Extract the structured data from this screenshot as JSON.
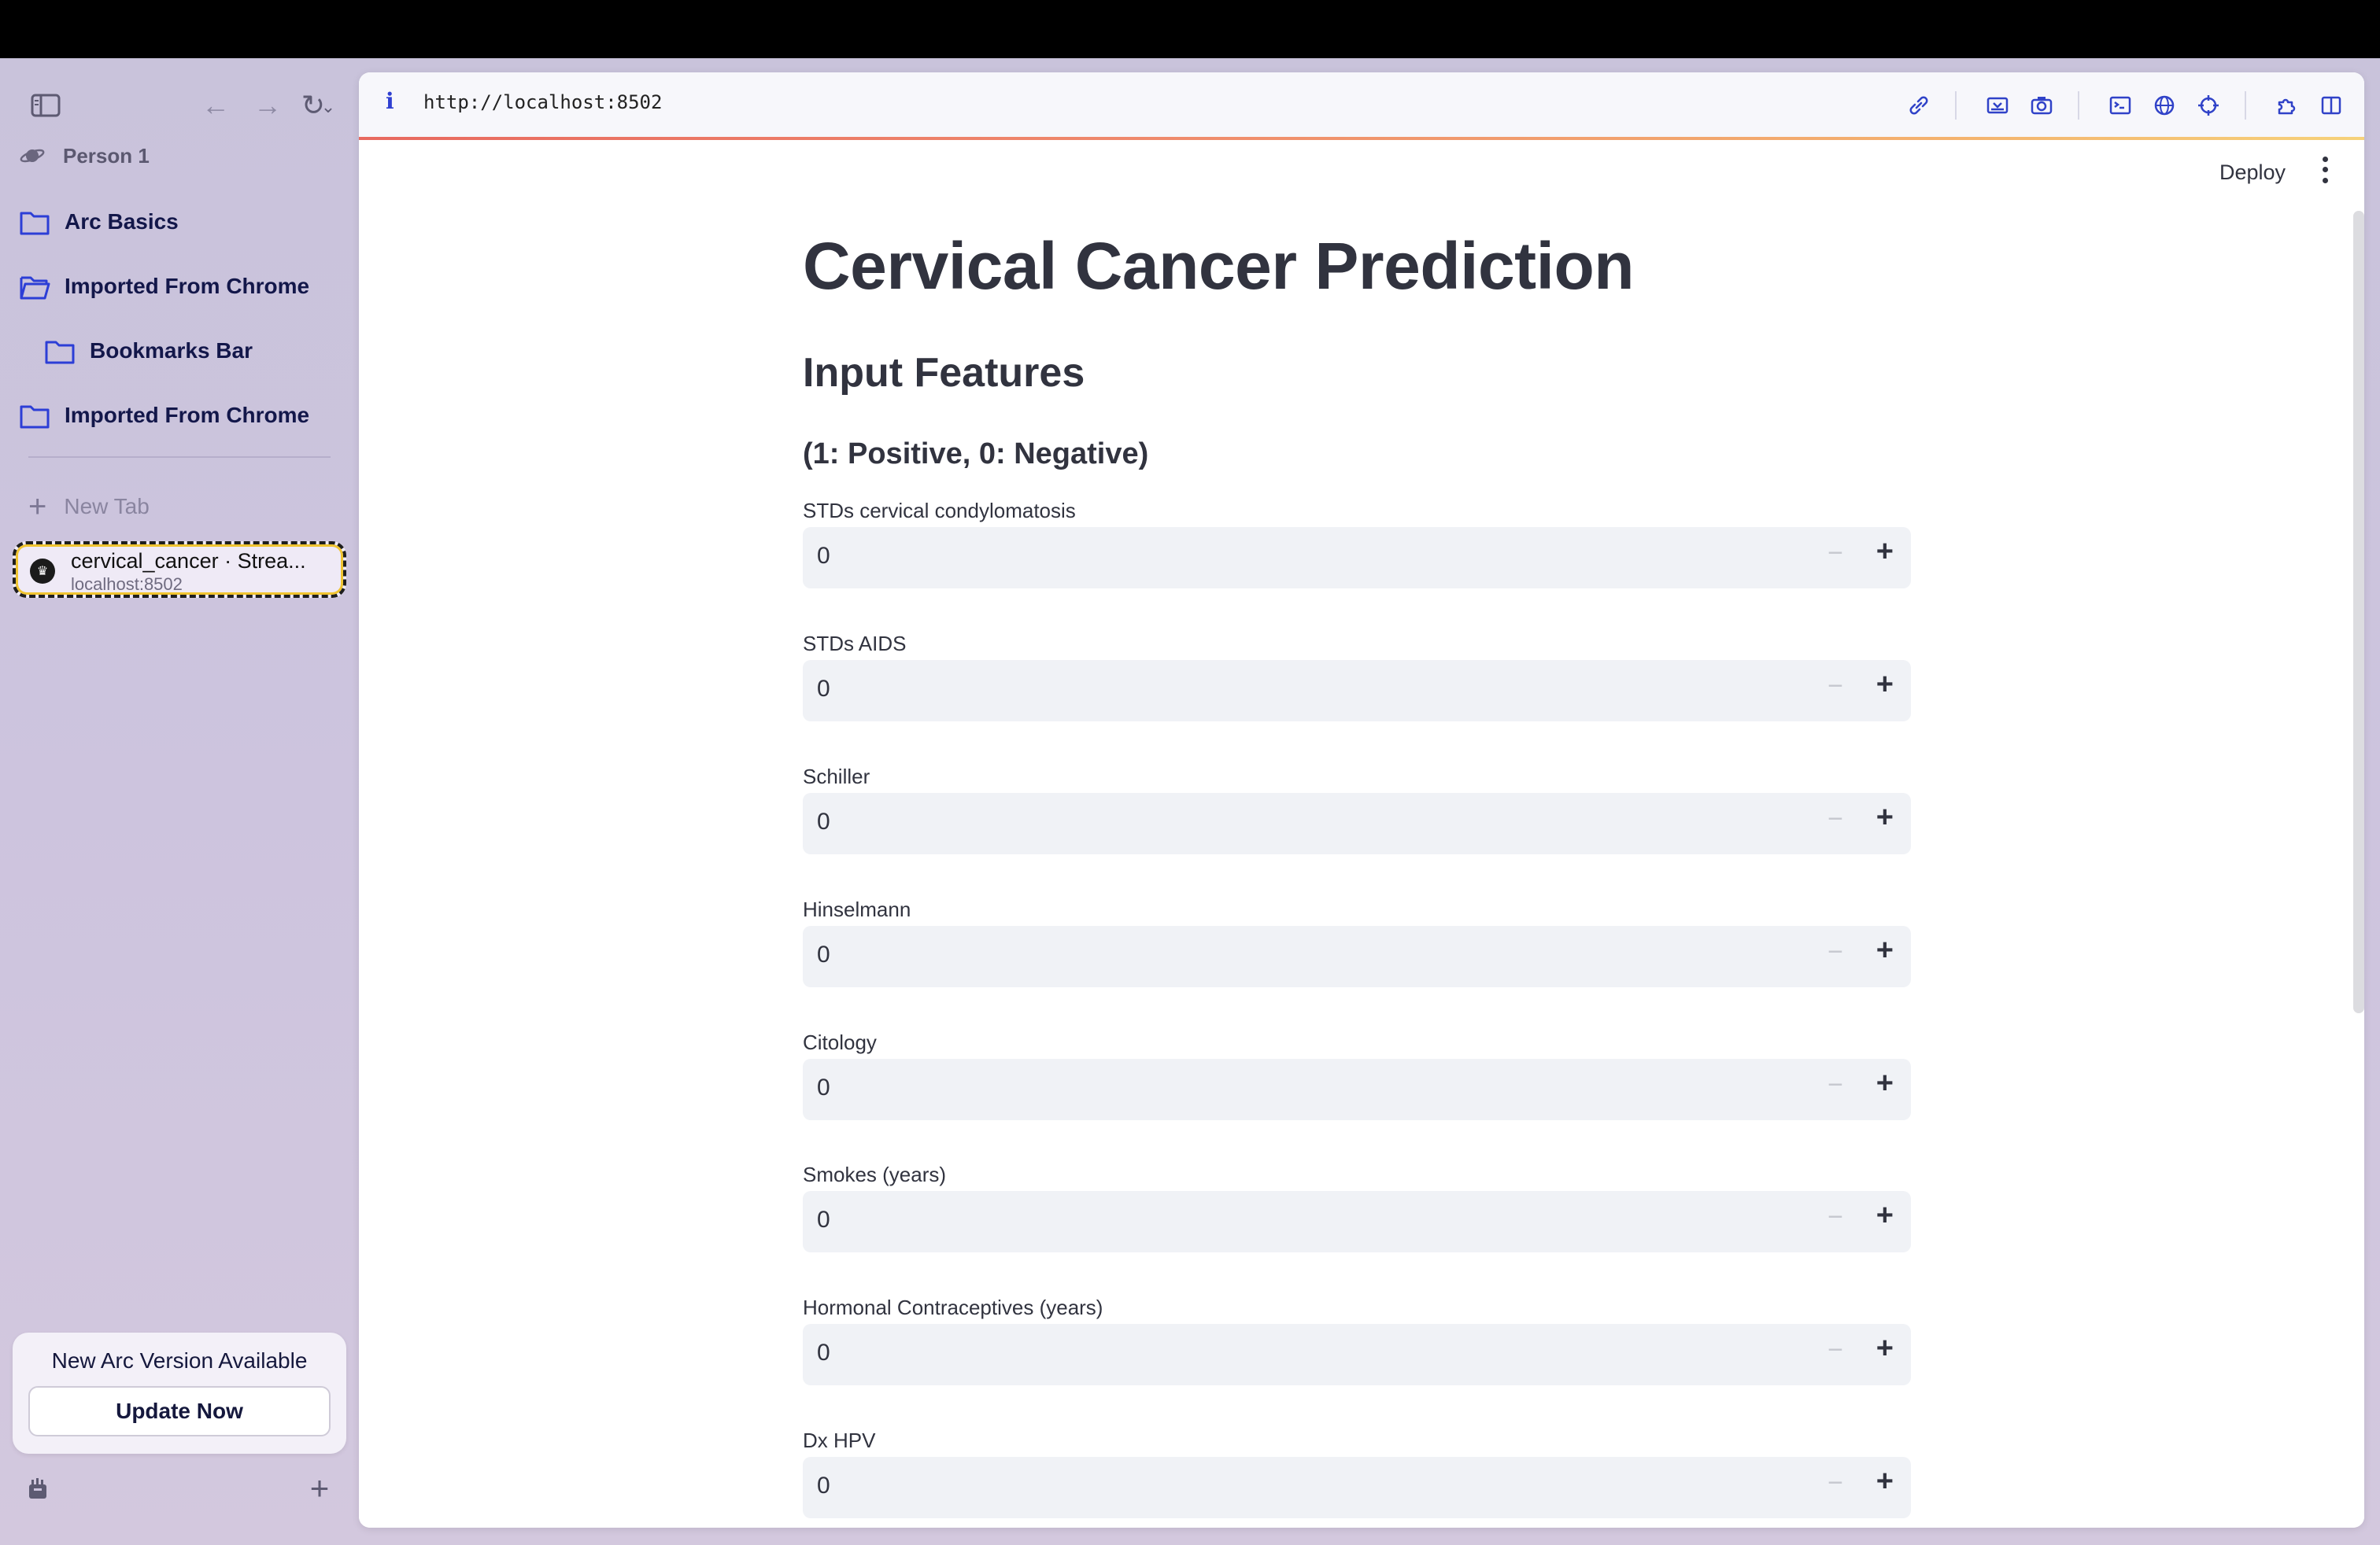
{
  "sidebar": {
    "profile": "Person 1",
    "items": [
      {
        "label": "Arc Basics"
      },
      {
        "label": "Imported From Chrome"
      },
      {
        "label": "Bookmarks Bar"
      },
      {
        "label": "Imported From Chrome"
      }
    ],
    "new_tab": "New Tab",
    "active_tab": {
      "title": "cervical_cancer · Strea...",
      "url": "localhost:8502"
    },
    "update": {
      "title": "New Arc Version Available",
      "button": "Update Now"
    }
  },
  "browser": {
    "url": "http://localhost:8502"
  },
  "app": {
    "deploy": "Deploy",
    "title": "Cervical Cancer Prediction",
    "subtitle": "Input Features",
    "note": "(1: Positive, 0: Negative)",
    "fields": [
      {
        "label": "STDs cervical condylomatosis",
        "value": "0"
      },
      {
        "label": "STDs AIDS",
        "value": "0"
      },
      {
        "label": "Schiller",
        "value": "0"
      },
      {
        "label": "Hinselmann",
        "value": "0"
      },
      {
        "label": "Citology",
        "value": "0"
      },
      {
        "label": "Smokes (years)",
        "value": "0"
      },
      {
        "label": "Hormonal Contraceptives (years)",
        "value": "0"
      },
      {
        "label": "Dx HPV",
        "value": "0"
      }
    ],
    "stepper_minus": "−",
    "stepper_plus": "+"
  }
}
